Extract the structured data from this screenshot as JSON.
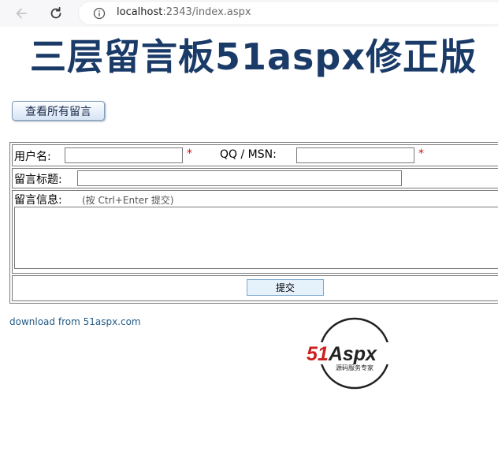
{
  "browser": {
    "url_host": "localhost",
    "url_rest": ":2343/index.aspx"
  },
  "page": {
    "title": "三层留言板51aspx修正版",
    "view_all_button": "查看所有留言"
  },
  "form": {
    "username_label": "用户名:",
    "required_mark": "*",
    "qq_msn_label": "QQ / MSN:",
    "subject_label": "留言标题:",
    "message_label": "留言信息:",
    "message_hint": "(按 Ctrl+Enter 提交)",
    "username_value": "",
    "qq_msn_value": "",
    "subject_value": "",
    "message_value": "",
    "submit_label": "提交"
  },
  "footer": {
    "link_text": "download from 51aspx.com",
    "logo_main_51": "51",
    "logo_main_aspx": "Aspx",
    "logo_tagline": "源码服务专家",
    "logo_colors": {
      "red": "#cc1f1f",
      "dark": "#222222",
      "green": "#2e9b3a"
    }
  }
}
